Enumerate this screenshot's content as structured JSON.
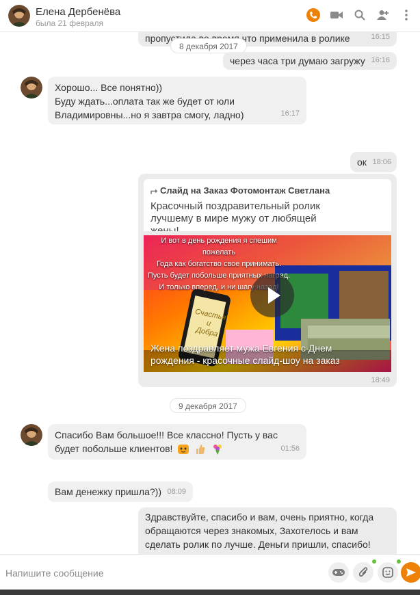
{
  "header": {
    "name": "Елена Дербенёва",
    "status": "была 21 февраля",
    "icons": [
      "call-icon",
      "video-call-icon",
      "search-icon",
      "add-user-icon",
      "more-icon"
    ],
    "accent": "#ee8208"
  },
  "messages": {
    "m1": {
      "text": "пропустила во время что применила в ролике",
      "time": "16:15"
    },
    "date1": "8 декабря 2017",
    "m2": {
      "text": "через часа три думаю загружу",
      "time": "16:16"
    },
    "m3": {
      "line1": "Хорошо... Все понятно))",
      "line2": "Буду ждать...оплата так же будет от юли",
      "line3": "Владимировны...но я завтра смогу, ладно)",
      "time": "16:17"
    },
    "m4": {
      "text": "ок",
      "time": "18:06"
    },
    "share": {
      "title": "Слайд на Заказ Фотомонтаж Светлана",
      "desc": "Красочный поздравительный ролик лучшему в мире мужу от любящей жены!",
      "video_lines": [
        "И вот в день рождения я спешим пожелать",
        "Года как богатство свое принимать.",
        "Пусть будет побольше приятных наград.",
        "И только вперед, и ни шагу назад!"
      ],
      "phone_text": [
        "Счастья",
        "и",
        "Добра"
      ],
      "video_caption": "Жена поздравляет мужа Евгения с Днем рождения - красочные слайд-шоу на заказ",
      "time": "18:49"
    },
    "date2": "9 декабря 2017",
    "m5": {
      "line1": "Спасибо Вам большое!!! Все классно! Пусть у вас",
      "line2": "будет побольше клиентов!",
      "time": "01:56"
    },
    "m6": {
      "text": "Вам денежку пришла?))",
      "time": "08:09"
    },
    "m7": {
      "line1": "Здравствуйте, спасибо и вам, очень приятно, когда",
      "line2": "обращаются через знакомых, Захотелось и вам",
      "line3": "сделать ролик по лучше. Деньги пришли, спасибо!"
    }
  },
  "input": {
    "placeholder": "Напишите сообщение",
    "buttons": [
      "gamepad-icon",
      "attach-icon",
      "emoji-icon",
      "send-icon"
    ]
  }
}
